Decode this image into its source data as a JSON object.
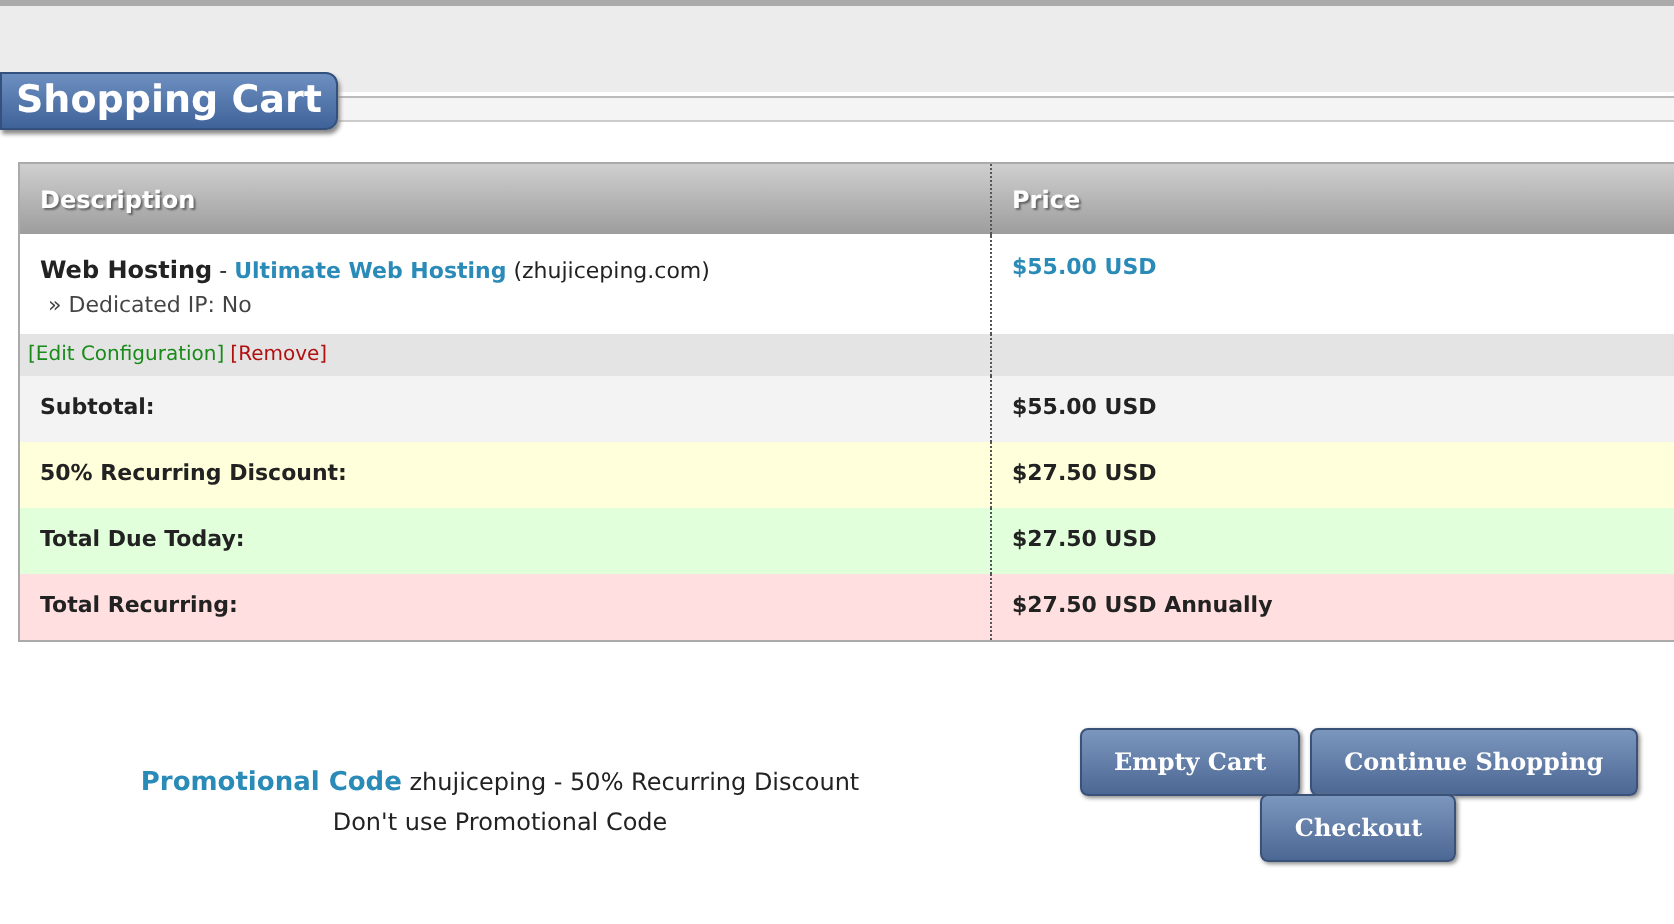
{
  "title": "Shopping Cart",
  "table": {
    "columns": [
      "Description",
      "Price"
    ],
    "item": {
      "group": "Web Hosting",
      "separator": "-",
      "product": "Ultimate Web Hosting",
      "domain": "(zhujiceping.com)",
      "option": "» Dedicated IP: No",
      "price": "$55.00 USD"
    },
    "actions": [
      {
        "kind": "edit",
        "label": "[Edit Configuration]"
      },
      {
        "kind": "remove",
        "label": "[Remove]"
      }
    ],
    "totals": [
      {
        "kind": "subtotal",
        "label": "Subtotal:",
        "value": "$55.00 USD"
      },
      {
        "kind": "discount",
        "label": "50% Recurring Discount:",
        "value": "$27.50 USD"
      },
      {
        "kind": "due",
        "label": "Total Due Today:",
        "value": "$27.50 USD"
      },
      {
        "kind": "recurring",
        "label": "Total Recurring:",
        "value": "$27.50 USD Annually"
      }
    ]
  },
  "promo": {
    "label": "Promotional Code",
    "text": "zhujiceping - 50% Recurring Discount",
    "remove": "Don't use Promotional Code"
  },
  "buttons": [
    [
      "Empty Cart",
      "Continue Shopping"
    ],
    [
      "Checkout"
    ]
  ]
}
